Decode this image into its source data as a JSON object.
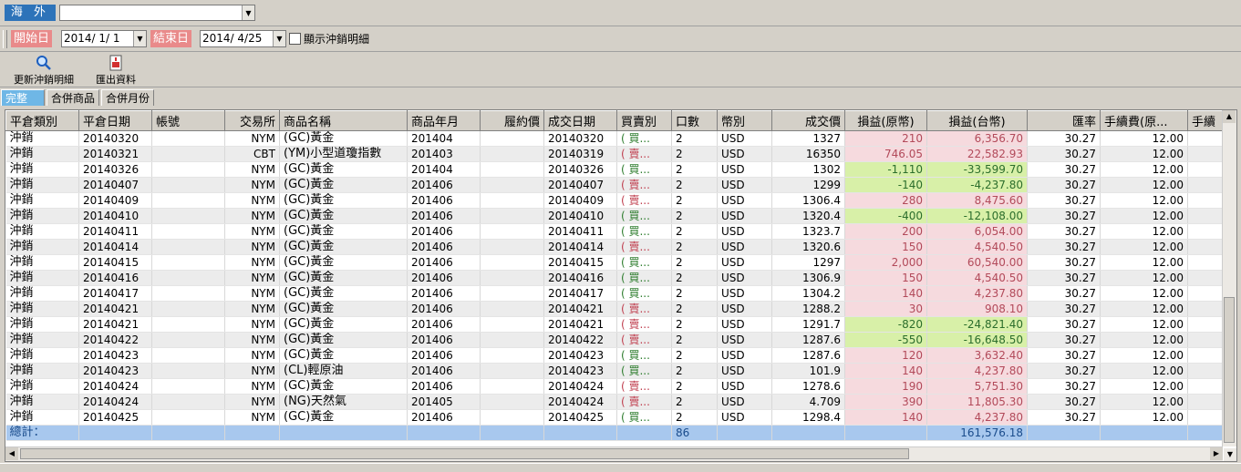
{
  "market": {
    "label": "海 外",
    "selected": ""
  },
  "filter": {
    "start_label": "開始日",
    "start_date": "2014/ 1/ 1",
    "end_label": "結束日",
    "end_date": "2014/ 4/25",
    "show_detail_label": "顯示沖銷明細",
    "show_detail_checked": false
  },
  "toolbar": {
    "refresh_label": "更新沖銷明細",
    "export_label": "匯出資料"
  },
  "tabs": [
    "完整",
    "合併商品",
    "合併月份"
  ],
  "table": {
    "columns": [
      "平倉類別",
      "平倉日期",
      "帳號",
      "交易所",
      "商品名稱",
      "商品年月",
      "履約價",
      "成交日期",
      "買賣別",
      "口數",
      "幣別",
      "成交價",
      "損益(原幣)",
      "損益(台幣)",
      "匯率",
      "手續費(原...",
      "手續"
    ],
    "rows": [
      {
        "type": "沖銷",
        "close_date": "20140320",
        "account": "",
        "exchange": "NYM",
        "product": "(GC)黃金",
        "month": "201404",
        "strike": "",
        "trade_date": "20140320",
        "side": "( 買...",
        "qty": "2",
        "currency": "USD",
        "price": "1327",
        "pl_orig": "210",
        "pl_twd": "6,356.70",
        "rate": "30.27",
        "fee": "12.00",
        "sign": "pos",
        "buy": true
      },
      {
        "type": "沖銷",
        "close_date": "20140321",
        "account": "",
        "exchange": "CBT",
        "product": "(YM)小型道瓊指數",
        "month": "201403",
        "strike": "",
        "trade_date": "20140319",
        "side": "( 賣...",
        "qty": "2",
        "currency": "USD",
        "price": "16350",
        "pl_orig": "746.05",
        "pl_twd": "22,582.93",
        "rate": "30.27",
        "fee": "12.00",
        "sign": "pos",
        "buy": false
      },
      {
        "type": "沖銷",
        "close_date": "20140326",
        "account": "",
        "exchange": "NYM",
        "product": "(GC)黃金",
        "month": "201404",
        "strike": "",
        "trade_date": "20140326",
        "side": "( 買...",
        "qty": "2",
        "currency": "USD",
        "price": "1302",
        "pl_orig": "-1,110",
        "pl_twd": "-33,599.70",
        "rate": "30.27",
        "fee": "12.00",
        "sign": "neg",
        "buy": true
      },
      {
        "type": "沖銷",
        "close_date": "20140407",
        "account": "",
        "exchange": "NYM",
        "product": "(GC)黃金",
        "month": "201406",
        "strike": "",
        "trade_date": "20140407",
        "side": "( 賣...",
        "qty": "2",
        "currency": "USD",
        "price": "1299",
        "pl_orig": "-140",
        "pl_twd": "-4,237.80",
        "rate": "30.27",
        "fee": "12.00",
        "sign": "neg",
        "buy": false
      },
      {
        "type": "沖銷",
        "close_date": "20140409",
        "account": "",
        "exchange": "NYM",
        "product": "(GC)黃金",
        "month": "201406",
        "strike": "",
        "trade_date": "20140409",
        "side": "( 賣...",
        "qty": "2",
        "currency": "USD",
        "price": "1306.4",
        "pl_orig": "280",
        "pl_twd": "8,475.60",
        "rate": "30.27",
        "fee": "12.00",
        "sign": "pos",
        "buy": false
      },
      {
        "type": "沖銷",
        "close_date": "20140410",
        "account": "",
        "exchange": "NYM",
        "product": "(GC)黃金",
        "month": "201406",
        "strike": "",
        "trade_date": "20140410",
        "side": "( 買...",
        "qty": "2",
        "currency": "USD",
        "price": "1320.4",
        "pl_orig": "-400",
        "pl_twd": "-12,108.00",
        "rate": "30.27",
        "fee": "12.00",
        "sign": "neg",
        "buy": true
      },
      {
        "type": "沖銷",
        "close_date": "20140411",
        "account": "",
        "exchange": "NYM",
        "product": "(GC)黃金",
        "month": "201406",
        "strike": "",
        "trade_date": "20140411",
        "side": "( 買...",
        "qty": "2",
        "currency": "USD",
        "price": "1323.7",
        "pl_orig": "200",
        "pl_twd": "6,054.00",
        "rate": "30.27",
        "fee": "12.00",
        "sign": "pos",
        "buy": true
      },
      {
        "type": "沖銷",
        "close_date": "20140414",
        "account": "",
        "exchange": "NYM",
        "product": "(GC)黃金",
        "month": "201406",
        "strike": "",
        "trade_date": "20140414",
        "side": "( 賣...",
        "qty": "2",
        "currency": "USD",
        "price": "1320.6",
        "pl_orig": "150",
        "pl_twd": "4,540.50",
        "rate": "30.27",
        "fee": "12.00",
        "sign": "pos",
        "buy": false
      },
      {
        "type": "沖銷",
        "close_date": "20140415",
        "account": "",
        "exchange": "NYM",
        "product": "(GC)黃金",
        "month": "201406",
        "strike": "",
        "trade_date": "20140415",
        "side": "( 買...",
        "qty": "2",
        "currency": "USD",
        "price": "1297",
        "pl_orig": "2,000",
        "pl_twd": "60,540.00",
        "rate": "30.27",
        "fee": "12.00",
        "sign": "pos",
        "buy": true
      },
      {
        "type": "沖銷",
        "close_date": "20140416",
        "account": "",
        "exchange": "NYM",
        "product": "(GC)黃金",
        "month": "201406",
        "strike": "",
        "trade_date": "20140416",
        "side": "( 買...",
        "qty": "2",
        "currency": "USD",
        "price": "1306.9",
        "pl_orig": "150",
        "pl_twd": "4,540.50",
        "rate": "30.27",
        "fee": "12.00",
        "sign": "pos",
        "buy": true
      },
      {
        "type": "沖銷",
        "close_date": "20140417",
        "account": "",
        "exchange": "NYM",
        "product": "(GC)黃金",
        "month": "201406",
        "strike": "",
        "trade_date": "20140417",
        "side": "( 買...",
        "qty": "2",
        "currency": "USD",
        "price": "1304.2",
        "pl_orig": "140",
        "pl_twd": "4,237.80",
        "rate": "30.27",
        "fee": "12.00",
        "sign": "pos",
        "buy": true
      },
      {
        "type": "沖銷",
        "close_date": "20140421",
        "account": "",
        "exchange": "NYM",
        "product": "(GC)黃金",
        "month": "201406",
        "strike": "",
        "trade_date": "20140421",
        "side": "( 賣...",
        "qty": "2",
        "currency": "USD",
        "price": "1288.2",
        "pl_orig": "30",
        "pl_twd": "908.10",
        "rate": "30.27",
        "fee": "12.00",
        "sign": "pos",
        "buy": false
      },
      {
        "type": "沖銷",
        "close_date": "20140421",
        "account": "",
        "exchange": "NYM",
        "product": "(GC)黃金",
        "month": "201406",
        "strike": "",
        "trade_date": "20140421",
        "side": "( 賣...",
        "qty": "2",
        "currency": "USD",
        "price": "1291.7",
        "pl_orig": "-820",
        "pl_twd": "-24,821.40",
        "rate": "30.27",
        "fee": "12.00",
        "sign": "neg",
        "buy": false
      },
      {
        "type": "沖銷",
        "close_date": "20140422",
        "account": "",
        "exchange": "NYM",
        "product": "(GC)黃金",
        "month": "201406",
        "strike": "",
        "trade_date": "20140422",
        "side": "( 賣...",
        "qty": "2",
        "currency": "USD",
        "price": "1287.6",
        "pl_orig": "-550",
        "pl_twd": "-16,648.50",
        "rate": "30.27",
        "fee": "12.00",
        "sign": "neg",
        "buy": false
      },
      {
        "type": "沖銷",
        "close_date": "20140423",
        "account": "",
        "exchange": "NYM",
        "product": "(GC)黃金",
        "month": "201406",
        "strike": "",
        "trade_date": "20140423",
        "side": "( 買...",
        "qty": "2",
        "currency": "USD",
        "price": "1287.6",
        "pl_orig": "120",
        "pl_twd": "3,632.40",
        "rate": "30.27",
        "fee": "12.00",
        "sign": "pos",
        "buy": true
      },
      {
        "type": "沖銷",
        "close_date": "20140423",
        "account": "",
        "exchange": "NYM",
        "product": "(CL)輕原油",
        "month": "201406",
        "strike": "",
        "trade_date": "20140423",
        "side": "( 買...",
        "qty": "2",
        "currency": "USD",
        "price": "101.9",
        "pl_orig": "140",
        "pl_twd": "4,237.80",
        "rate": "30.27",
        "fee": "12.00",
        "sign": "pos",
        "buy": true
      },
      {
        "type": "沖銷",
        "close_date": "20140424",
        "account": "",
        "exchange": "NYM",
        "product": "(GC)黃金",
        "month": "201406",
        "strike": "",
        "trade_date": "20140424",
        "side": "( 賣...",
        "qty": "2",
        "currency": "USD",
        "price": "1278.6",
        "pl_orig": "190",
        "pl_twd": "5,751.30",
        "rate": "30.27",
        "fee": "12.00",
        "sign": "pos",
        "buy": false
      },
      {
        "type": "沖銷",
        "close_date": "20140424",
        "account": "",
        "exchange": "NYM",
        "product": "(NG)天然氣",
        "month": "201405",
        "strike": "",
        "trade_date": "20140424",
        "side": "( 賣...",
        "qty": "2",
        "currency": "USD",
        "price": "4.709",
        "pl_orig": "390",
        "pl_twd": "11,805.30",
        "rate": "30.27",
        "fee": "12.00",
        "sign": "pos",
        "buy": false
      },
      {
        "type": "沖銷",
        "close_date": "20140425",
        "account": "",
        "exchange": "NYM",
        "product": "(GC)黃金",
        "month": "201406",
        "strike": "",
        "trade_date": "20140425",
        "side": "( 買...",
        "qty": "2",
        "currency": "USD",
        "price": "1298.4",
        "pl_orig": "140",
        "pl_twd": "4,237.80",
        "rate": "30.27",
        "fee": "12.00",
        "sign": "pos",
        "buy": true
      }
    ],
    "total": {
      "label": "總計：",
      "qty": "86",
      "pl_twd": "161,576.18"
    }
  },
  "colors": {
    "pos_bg": "#f6dade",
    "neg_bg": "#d8f0a8",
    "total_bg": "#a8c8ee",
    "tab_active": "#6fb7e6",
    "date_label": "#e98a8a"
  }
}
